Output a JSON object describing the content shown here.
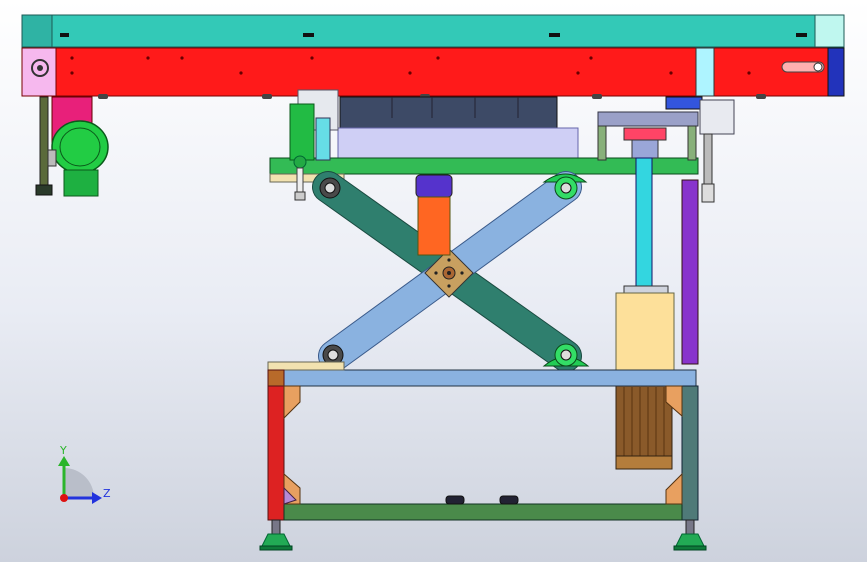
{
  "view": {
    "background_top": "#ffffff",
    "background_bottom": "#cdd2dd"
  },
  "axes_triad": {
    "y_label": "Y",
    "z_label": "Z",
    "y_color": "#2bb52b",
    "z_color": "#2233dd",
    "x_dot_color": "#dd1111"
  },
  "colors": {
    "top_rail": "#33c9b7",
    "red_beam": "#ff1a1a",
    "motor_green": "#22cc44",
    "magenta_guard": "#e8207a",
    "green_plate": "#33bb55",
    "platform_lavender": "#cfcff5",
    "dark_block": "#3d4a66",
    "scissor_dark": "#2f7f6e",
    "scissor_light": "#8ab2e0",
    "cylinder_orange": "#ff6622",
    "cylinder_purple": "#5533cc",
    "rod_cyan": "#33d6e0",
    "motor_brown": "#8a5a2a",
    "beige_block": "#fde09a",
    "violet_post": "#8833cc",
    "base_top_blue": "#8ab2e0",
    "base_leg_red": "#dd2222",
    "base_leg_grey": "#4f7a78",
    "base_bottom_green": "#4a8a4a",
    "foot_green": "#22aa55",
    "bracket_orange": "#e8a060",
    "bracket_purple": "#b58ad6"
  }
}
